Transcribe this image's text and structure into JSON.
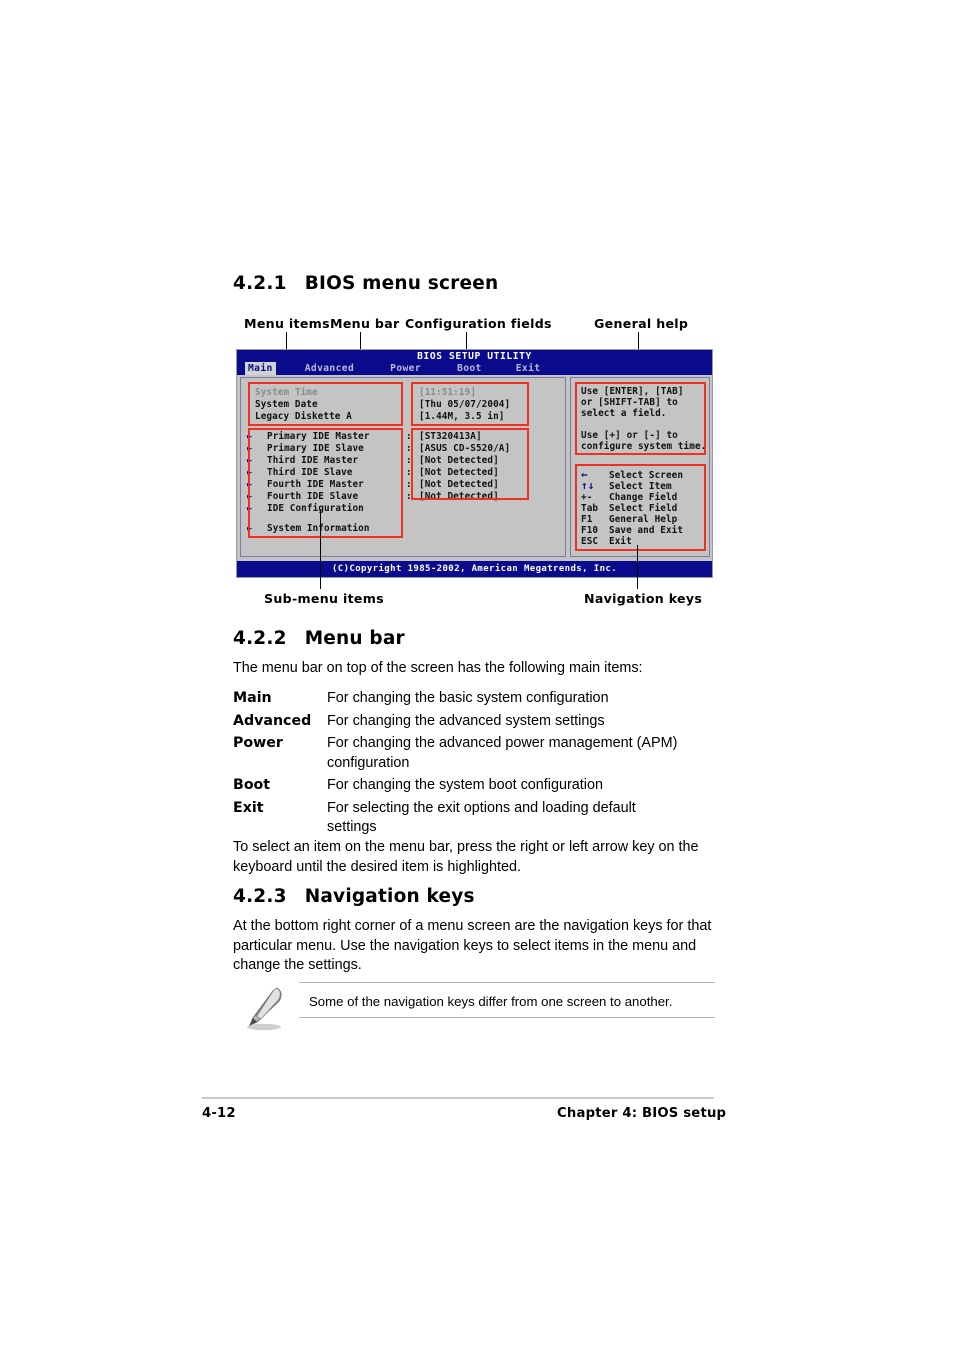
{
  "sections": {
    "s421": {
      "number": "4.2.1",
      "title": "BIOS menu screen"
    },
    "s422": {
      "number": "4.2.2",
      "title": "Menu bar"
    },
    "s423": {
      "number": "4.2.3",
      "title": "Navigation keys"
    }
  },
  "callouts": {
    "menu_items": "Menu items",
    "menu_bar": "Menu bar",
    "config_fields": "Configuration fields",
    "general_help": "General help",
    "submenu_items": "Sub-menu items",
    "navigation_keys": "Navigation keys"
  },
  "bios": {
    "title": "BIOS SETUP UTILITY",
    "tabs": [
      {
        "label": "Main",
        "active": true
      },
      {
        "label": "Advanced",
        "active": false
      },
      {
        "label": "Power",
        "active": false
      },
      {
        "label": "Boot",
        "active": false
      },
      {
        "label": "Exit",
        "active": false
      }
    ],
    "settings": [
      {
        "name": "System Time",
        "value": "[11:51:19]",
        "dim": true
      },
      {
        "name": "System Date",
        "value": "[Thu 05/07/2004]",
        "dim": false
      },
      {
        "name": "Legacy Diskette A",
        "value": "[1.44M, 3.5 in]",
        "dim": false
      }
    ],
    "submenus": [
      {
        "name": "Primary IDE Master",
        "sep": ":",
        "value": "[ST320413A]"
      },
      {
        "name": "Primary IDE Slave",
        "sep": ":",
        "value": "[ASUS CD-S520/A]"
      },
      {
        "name": "Third IDE Master",
        "sep": ":",
        "value": "[Not Detected]"
      },
      {
        "name": "Third IDE Slave",
        "sep": ":",
        "value": "[Not Detected]"
      },
      {
        "name": "Fourth IDE Master",
        "sep": ":",
        "value": "[Not Detected]"
      },
      {
        "name": "Fourth IDE Slave",
        "sep": ":",
        "value": "[Not Detected]"
      },
      {
        "name": "IDE Configuration",
        "sep": "",
        "value": ""
      }
    ],
    "submenus_extra": [
      {
        "name": "System Information",
        "sep": "",
        "value": ""
      }
    ],
    "help_lines": [
      "Use [ENTER], [TAB]",
      "or [SHIFT-TAB] to",
      "select a field.",
      "",
      "Use [+] or [-] to",
      "configure system time."
    ],
    "nav_keys": [
      {
        "key": "←",
        "desc": "Select Screen"
      },
      {
        "key": "↑↓",
        "desc": "Select Item"
      },
      {
        "key": "+-",
        "desc": "Change Field"
      },
      {
        "key": "Tab",
        "desc": "Select Field"
      },
      {
        "key": "F1",
        "desc": "General Help"
      },
      {
        "key": "F10",
        "desc": "Save and Exit"
      },
      {
        "key": "ESC",
        "desc": "Exit"
      }
    ],
    "copyright": "(C)Copyright 1985-2002, American Megatrends, Inc.",
    "colors": {
      "chrome_blue": "#0a0a8c",
      "panel_gray": "#c4c4c4",
      "annotation_red": "#ef3124"
    }
  },
  "menubar_section": {
    "intro": "The menu bar on top of the screen has the following main items:",
    "items": [
      {
        "term": "Main",
        "desc": "For changing the basic system configuration"
      },
      {
        "term": "Advanced",
        "desc": "For changing the advanced system settings"
      },
      {
        "term": "Power",
        "desc": "For changing the advanced power management (APM) configuration"
      },
      {
        "term": "Boot",
        "desc": "For changing the system boot configuration"
      },
      {
        "term": "Exit",
        "desc": "For selecting the exit options and loading default settings"
      }
    ],
    "outro": "To select an item on the menu bar, press the right or left arrow key on the keyboard until the desired item is highlighted."
  },
  "navkeys_section": {
    "paragraph": "At the bottom right corner of a menu screen are the navigation keys for that particular menu. Use the navigation keys to select items in the menu and change the settings.",
    "note": "Some of the navigation keys differ from one screen to another."
  },
  "footer": {
    "page_number": "4-12",
    "chapter": "Chapter 4: BIOS setup"
  }
}
